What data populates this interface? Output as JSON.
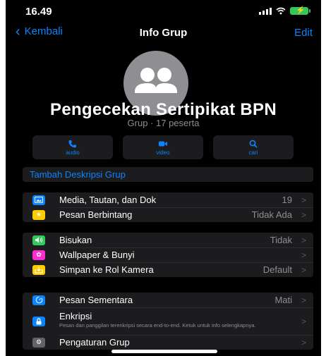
{
  "status": {
    "time": "16.49"
  },
  "nav": {
    "back_label": "Kembali",
    "title": "Info Grup",
    "edit_label": "Edit"
  },
  "group": {
    "name": "Pengecekan Sertipikat BPN",
    "subtitle": "Grup · 17 peserta"
  },
  "actions": [
    {
      "label": "audio",
      "icon": "phone-icon"
    },
    {
      "label": "video",
      "icon": "video-camera-icon"
    },
    {
      "label": "cari",
      "icon": "search-icon"
    }
  ],
  "description_link": "Tambah Deskripsi Grup",
  "section1": [
    {
      "label": "Media, Tautan, dan Dok",
      "value": "19",
      "icon": "photo-icon",
      "color": "#0a84ff"
    },
    {
      "label": "Pesan Berbintang",
      "value": "Tidak Ada",
      "icon": "star-icon",
      "color": "#ffcc00"
    }
  ],
  "section2": [
    {
      "label": "Bisukan",
      "value": "Tidak",
      "icon": "speaker-icon",
      "color": "#34c759"
    },
    {
      "label": "Wallpaper & Bunyi",
      "value": "",
      "icon": "flower-icon",
      "color": "#ff2dd1"
    },
    {
      "label": "Simpan ke Rol Kamera",
      "value": "Default",
      "icon": "download-icon",
      "color": "#ffcc00"
    }
  ],
  "section3": [
    {
      "label": "Pesan Sementara",
      "value": "Mati",
      "icon": "timer-icon",
      "color": "#0a84ff"
    },
    {
      "label": "Enkripsi",
      "sub": "Pesan dan panggilan terenkripsi secara end-to-end. Ketuk untuk info selengkapnya.",
      "icon": "lock-icon",
      "color": "#0a84ff"
    },
    {
      "label": "Pengaturan Grup",
      "value": "",
      "icon": "gear-icon",
      "color": "#636366"
    }
  ],
  "chevron": ">"
}
